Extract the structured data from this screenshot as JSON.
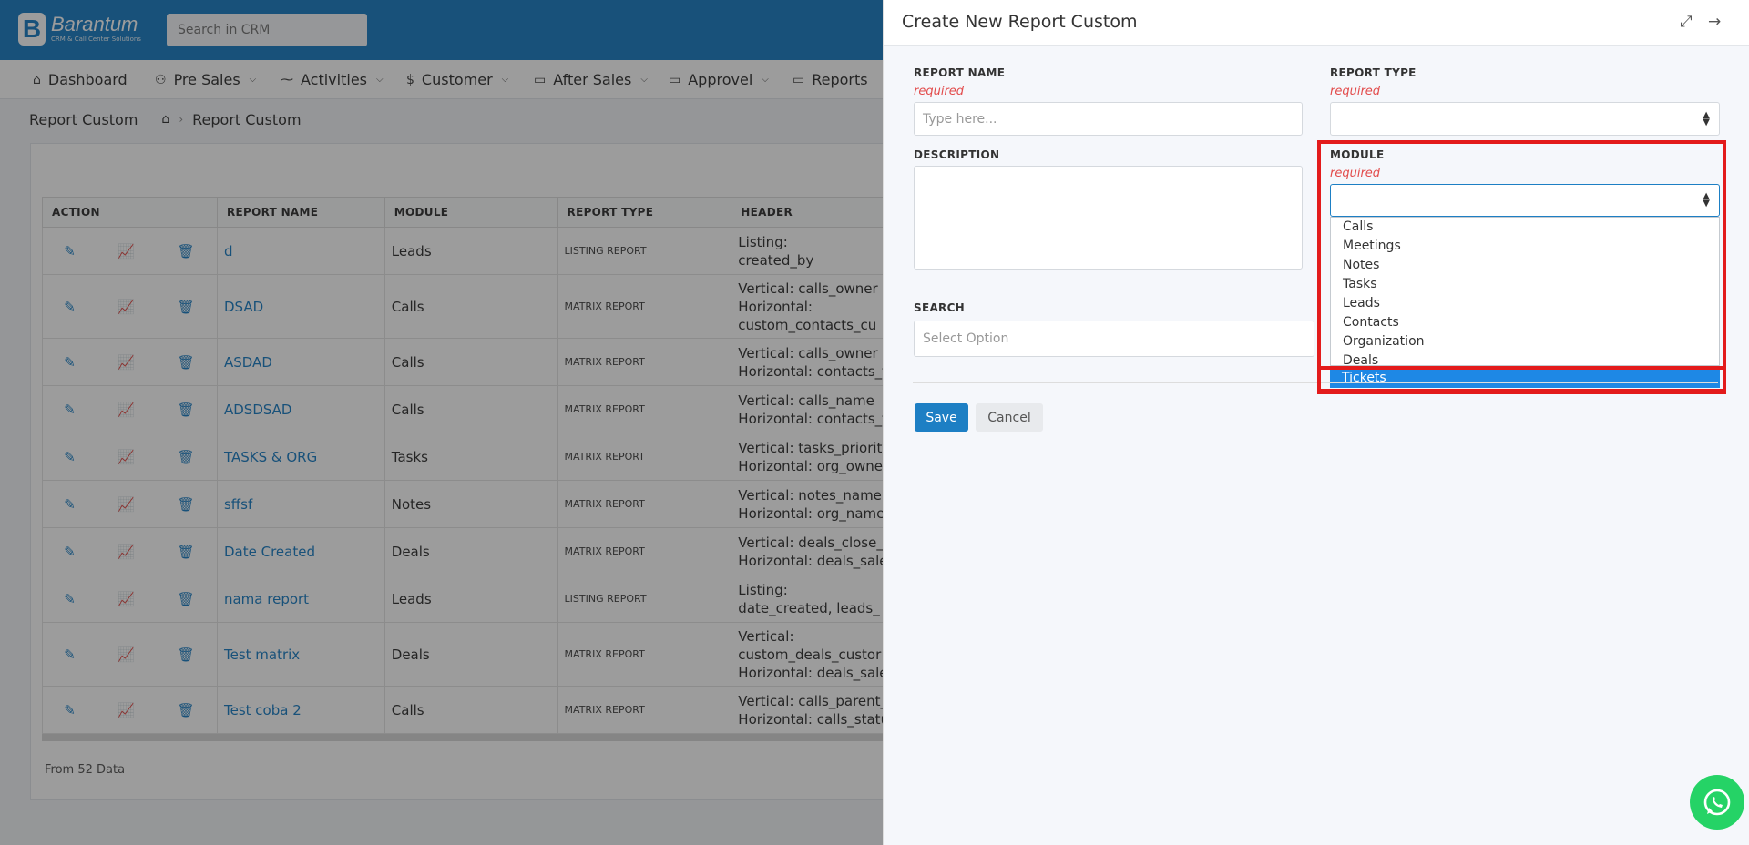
{
  "topbar": {
    "brand": "Barantum",
    "brand_sub": "CRM & Call Center Solutions",
    "search_placeholder": "Search in CRM"
  },
  "nav": [
    {
      "label": "Dashboard",
      "icon": "home-icon"
    },
    {
      "label": "Pre Sales",
      "icon": "users-icon"
    },
    {
      "label": "Activities",
      "icon": "activity-icon"
    },
    {
      "label": "Customer",
      "icon": "dollar-icon"
    },
    {
      "label": "After Sales",
      "icon": "folder-icon"
    },
    {
      "label": "Approvel",
      "icon": "folder-icon"
    },
    {
      "label": "Reports",
      "icon": "folder-icon"
    }
  ],
  "breadcrumb": {
    "title": "Report Custom",
    "current": "Report Custom"
  },
  "table": {
    "headers": [
      "ACTION",
      "REPORT NAME",
      "MODULE",
      "REPORT TYPE",
      "HEADER"
    ],
    "rows": [
      {
        "name": "d",
        "module": "Leads",
        "type": "LISTING REPORT",
        "header": "Listing:\ncreated_by"
      },
      {
        "name": "DSAD",
        "module": "Calls",
        "type": "MATRIX REPORT",
        "header": "Vertical: calls_owner\nHorizontal:\ncustom_contacts_cu"
      },
      {
        "name": "ASDAD",
        "module": "Calls",
        "type": "MATRIX REPORT",
        "header": "Vertical: calls_owner\nHorizontal: contacts_f"
      },
      {
        "name": "ADSDSAD",
        "module": "Calls",
        "type": "MATRIX REPORT",
        "header": "Vertical: calls_name\nHorizontal: contacts_f"
      },
      {
        "name": "TASKS & ORG",
        "module": "Tasks",
        "type": "MATRIX REPORT",
        "header": "Vertical: tasks_priority\nHorizontal: org_owner"
      },
      {
        "name": "sffsf",
        "module": "Notes",
        "type": "MATRIX REPORT",
        "header": "Vertical: notes_name\nHorizontal: org_name"
      },
      {
        "name": "Date Created",
        "module": "Deals",
        "type": "MATRIX REPORT",
        "header": "Vertical: deals_close_\nHorizontal: deals_sale"
      },
      {
        "name": "nama report",
        "module": "Leads",
        "type": "LISTING REPORT",
        "header": "Listing:\ndate_created, leads_"
      },
      {
        "name": "Test matrix",
        "module": "Deals",
        "type": "MATRIX REPORT",
        "header": "Vertical:\ncustom_deals_custor\nHorizontal: deals_sale"
      },
      {
        "name": "Test coba 2",
        "module": "Calls",
        "type": "MATRIX REPORT",
        "header": "Vertical: calls_parent_\nHorizontal: calls_statu"
      }
    ],
    "footer": "From 52 Data"
  },
  "drawer": {
    "title": "Create New Report Custom",
    "report_name_label": "REPORT NAME",
    "report_name_required": "required",
    "report_name_placeholder": "Type here...",
    "report_type_label": "REPORT TYPE",
    "report_type_required": "required",
    "description_label": "DESCRIPTION",
    "module_label": "MODULE",
    "module_required": "required",
    "search_label": "SEARCH",
    "search_placeholder": "Select Option",
    "save": "Save",
    "cancel": "Cancel",
    "module_options": [
      "Calls",
      "Meetings",
      "Notes",
      "Tasks",
      "Leads",
      "Contacts",
      "Organization",
      "Deals",
      "Tickets"
    ],
    "module_highlighted": "Tickets"
  },
  "colors": {
    "brand": "#1d7fc4",
    "required": "#e24b4b",
    "highlight": "#e31b1b",
    "whatsapp": "#25d366"
  }
}
